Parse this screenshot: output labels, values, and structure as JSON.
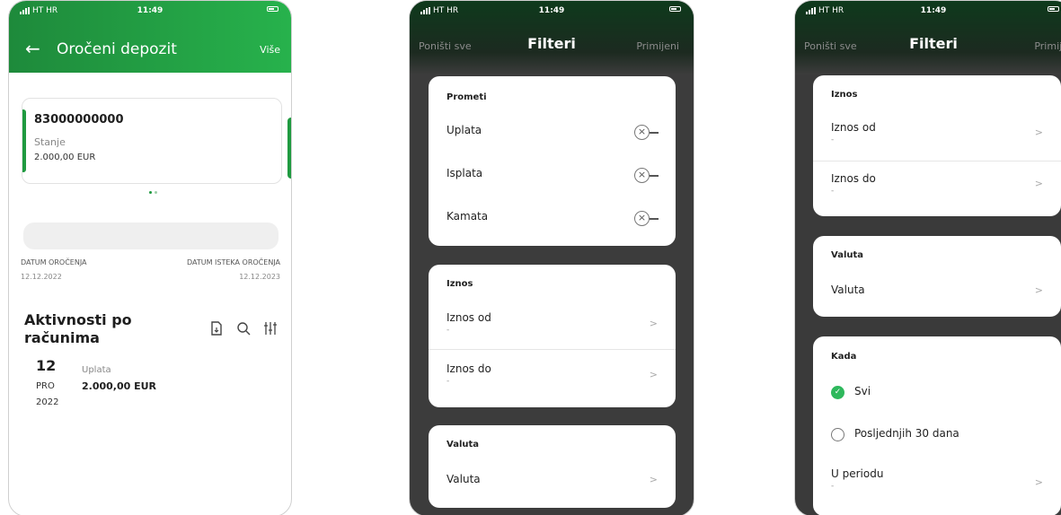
{
  "status": {
    "carrier": "HT HR",
    "time": "11:49"
  },
  "account_screen": {
    "back_label": "←",
    "title": "Oročeni depozit",
    "more": "Više",
    "account_number": "83000000000",
    "balance_label": "Stanje",
    "balance_value": "2.000,00 EUR",
    "start_date_label": "DATUM OROČENJA",
    "start_date": "12.12.2022",
    "end_date_label": "DATUM ISTEKA OROČENJA",
    "end_date": "12.12.2023",
    "activity_title": "Aktivnosti po računima",
    "transaction": {
      "day": "12",
      "month": "PRO",
      "year": "2022",
      "type": "Uplata",
      "amount": "2.000,00 EUR"
    }
  },
  "filters": {
    "reset": "Poništi sve",
    "title": "Filteri",
    "apply": "Primijeni",
    "turnover_title": "Prometi",
    "turnover_items": [
      "Uplata",
      "Isplata",
      "Kamata"
    ],
    "amount_title": "Iznos",
    "amount_from": "Iznos od",
    "amount_to": "Iznos do",
    "empty_value": "-",
    "currency_title": "Valuta",
    "currency_row": "Valuta",
    "when_title": "Kada",
    "when_options": [
      "Svi",
      "Posljednjih 30 dana"
    ],
    "period_row": "U periodu"
  },
  "colors": {
    "brand_green": "#1f9a40",
    "radio_on": "#2eb85c",
    "dim_overlay": "#3c3c3c"
  }
}
